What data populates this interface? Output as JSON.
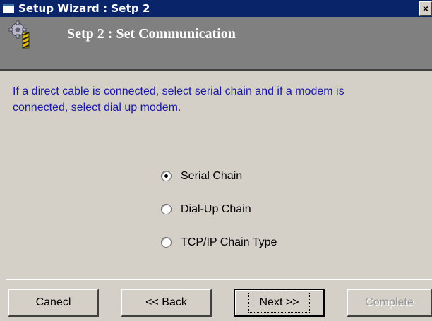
{
  "window": {
    "title": "Setup Wizard : Setp 2",
    "close_label": "×"
  },
  "header": {
    "step_title": "Setp 2 : Set Communication",
    "icon": "gear-wizard-icon"
  },
  "instruction": "If a direct cable is connected, select serial chain and if a modem is connected, select dial up modem.",
  "options": [
    {
      "label": "Serial Chain",
      "selected": true
    },
    {
      "label": "Dial-Up Chain",
      "selected": false
    },
    {
      "label": "TCP/IP Chain Type",
      "selected": false
    }
  ],
  "buttons": {
    "cancel": "Canecl",
    "back": "<< Back",
    "next": "Next >>",
    "complete": "Complete"
  },
  "colors": {
    "titlebar": "#0a246a",
    "header_band": "#808080",
    "instruction_text": "#1a1aa0",
    "dialog_bg": "#d4d0c8"
  }
}
